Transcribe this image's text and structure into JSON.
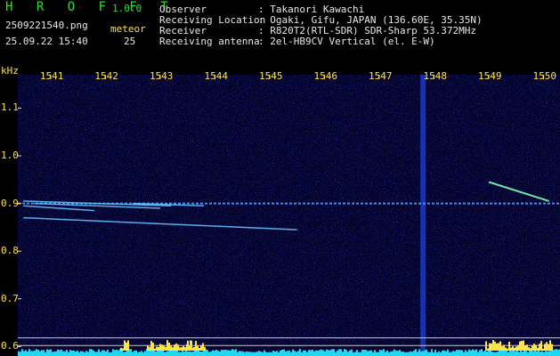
{
  "header": {
    "app_name": "H R O F F T",
    "version": "1.0.0",
    "filename": "2509221540.png",
    "datetime": "25.09.22 15:40",
    "meteor_label": "meteor",
    "meteor_count": "25",
    "info_labels": [
      "Observer",
      "Receiving Location",
      "Receiver",
      "Receiving antenna"
    ],
    "info_values": [
      ": Takanori Kawachi",
      ": Ogaki, Gifu, JAPAN (136.60E, 35.35N)",
      ": R820T2(RTL-SDR) SDR-Sharp 53.372MHz",
      ": 2el-HB9CV Vertical (el. E-W)"
    ]
  },
  "colors": {
    "background": "#000000",
    "header_text": "#2fe02f",
    "axis_text": "#ffe34a",
    "plot_base": "#04042e",
    "meteor_trace": "#80ffd0",
    "level_bar": "#22d8f0"
  },
  "chart_data": {
    "type": "heatmap",
    "x_axis_unit_label": "",
    "y_axis_unit_label": "kHz",
    "x_ticks": [
      "1541",
      "1542",
      "1543",
      "1544",
      "1545",
      "1546",
      "1547",
      "1548",
      "1549",
      "1550"
    ],
    "y_ticks": [
      "1.1",
      "1.0",
      "0.9",
      "0.8",
      "0.7",
      "0.6"
    ],
    "y_range_khz": [
      0.58,
      1.17
    ],
    "x_range": [
      1540.4,
      1550.3
    ],
    "carrier_khz": 0.9,
    "vertical_interference_x": 1547.8,
    "meteor_traces": [
      {
        "x_start": 1540.5,
        "x_end": 1543.2,
        "y_start": 0.905,
        "y_end": 0.895
      },
      {
        "x_start": 1542.5,
        "x_end": 1543.8,
        "y_start": 0.9,
        "y_end": 0.895
      },
      {
        "x_start": 1540.7,
        "x_end": 1543.0,
        "y_start": 0.9,
        "y_end": 0.89
      },
      {
        "x_start": 1540.5,
        "x_end": 1541.8,
        "y_start": 0.895,
        "y_end": 0.885
      },
      {
        "x_start": 1540.5,
        "x_end": 1545.5,
        "y_start": 0.87,
        "y_end": 0.845
      },
      {
        "x_start": 1549.0,
        "x_end": 1550.1,
        "y_start": 0.945,
        "y_end": 0.905
      }
    ],
    "reference_lines_khz": [
      0.618,
      0.602
    ]
  }
}
